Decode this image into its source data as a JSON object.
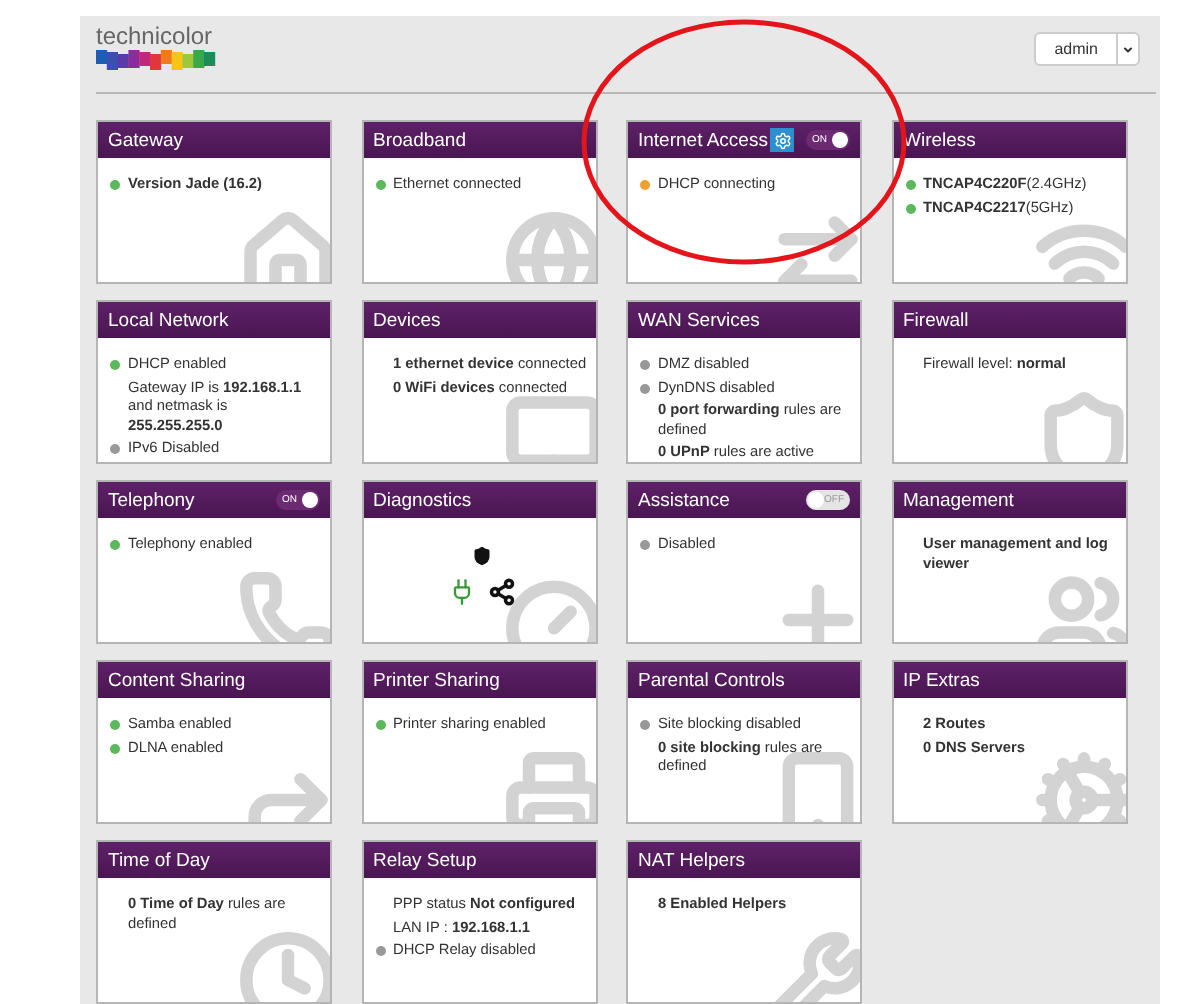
{
  "logo": {
    "text": "technicolor"
  },
  "user_menu": {
    "label": "admin"
  },
  "cards": [
    {
      "title": "Gateway",
      "lines": [
        {
          "kind": "status",
          "color": "#5cb85c",
          "text": "Version Jade (16.2)",
          "bold": true
        }
      ]
    },
    {
      "title": "Broadband",
      "lines": [
        {
          "kind": "status",
          "color": "#5cb85c",
          "text": "Ethernet connected"
        }
      ]
    },
    {
      "title": "Internet Access",
      "settings_button": true,
      "toggle": {
        "label": "ON",
        "on": true
      },
      "circled": true,
      "lines": [
        {
          "kind": "status",
          "color": "#f0a030",
          "text": "DHCP connecting"
        }
      ]
    },
    {
      "title": "Wireless",
      "lines": [
        {
          "kind": "status",
          "color": "#5cb85c",
          "text": "**TNCAP4C220F**(2.4GHz)"
        },
        {
          "kind": "status",
          "color": "#5cb85c",
          "text": "**TNCAP4C2217**(5GHz)"
        }
      ]
    },
    {
      "title": "Local Network",
      "lines": [
        {
          "kind": "status",
          "color": "#5cb85c",
          "text": "DHCP enabled"
        },
        {
          "kind": "text",
          "text": "Gateway IP is **192.168.1.1** and netmask is **255.255.255.0**"
        },
        {
          "kind": "status",
          "color": "#999999",
          "text": "IPv6 Disabled"
        }
      ]
    },
    {
      "title": "Devices",
      "lines": [
        {
          "kind": "text",
          "text": "**1 ethernet device** connected"
        },
        {
          "kind": "text",
          "text": "**0 WiFi devices** connected"
        }
      ]
    },
    {
      "title": "WAN Services",
      "lines": [
        {
          "kind": "status",
          "color": "#999999",
          "text": "DMZ disabled"
        },
        {
          "kind": "status",
          "color": "#999999",
          "text": "DynDNS disabled"
        },
        {
          "kind": "text",
          "text": "**0 port forwarding** rules are defined"
        },
        {
          "kind": "text",
          "text": "**0 UPnP** rules are active"
        }
      ]
    },
    {
      "title": "Firewall",
      "lines": [
        {
          "kind": "text",
          "text": "Firewall level: **normal**"
        }
      ]
    },
    {
      "title": "Telephony",
      "toggle": {
        "label": "ON",
        "on": true
      },
      "lines": [
        {
          "kind": "status",
          "color": "#5cb85c",
          "text": "Telephony enabled"
        }
      ]
    },
    {
      "title": "Diagnostics"
    },
    {
      "title": "Assistance",
      "toggle": {
        "label": "OFF",
        "on": false
      },
      "lines": [
        {
          "kind": "status",
          "color": "#999999",
          "text": "Disabled"
        }
      ]
    },
    {
      "title": "Management",
      "lines": [
        {
          "kind": "text",
          "text": "User management and log viewer",
          "bold": true
        }
      ]
    },
    {
      "title": "Content Sharing",
      "lines": [
        {
          "kind": "status",
          "color": "#5cb85c",
          "text": "Samba enabled"
        },
        {
          "kind": "status",
          "color": "#5cb85c",
          "text": "DLNA enabled"
        }
      ]
    },
    {
      "title": "Printer Sharing",
      "lines": [
        {
          "kind": "status",
          "color": "#5cb85c",
          "text": "Printer sharing enabled"
        }
      ]
    },
    {
      "title": "Parental Controls",
      "lines": [
        {
          "kind": "status",
          "color": "#999999",
          "text": "Site blocking disabled"
        },
        {
          "kind": "text",
          "text": "**0 site blocking** rules are defined"
        }
      ]
    },
    {
      "title": "IP Extras",
      "lines": [
        {
          "kind": "text",
          "text": "2 Routes",
          "bold": true
        },
        {
          "kind": "text",
          "text": "0 DNS Servers",
          "bold": true
        }
      ]
    },
    {
      "title": "Time of Day",
      "lines": [
        {
          "kind": "text",
          "text": "**0 Time of Day** rules are defined"
        }
      ]
    },
    {
      "title": "Relay Setup",
      "lines": [
        {
          "kind": "text",
          "text": "PPP status **Not configured**"
        },
        {
          "kind": "text",
          "text": "LAN IP : **192.168.1.1**"
        },
        {
          "kind": "status",
          "color": "#999999",
          "text": "DHCP Relay disabled"
        }
      ]
    },
    {
      "title": "NAT Helpers",
      "lines": [
        {
          "kind": "text",
          "text": "8 Enabled Helpers",
          "bold": true
        }
      ]
    }
  ]
}
